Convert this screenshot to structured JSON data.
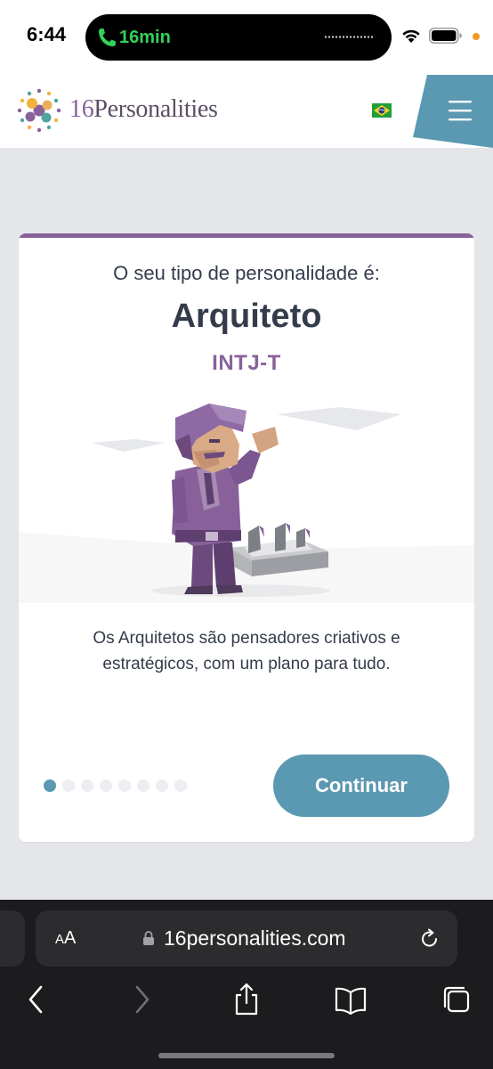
{
  "status_bar": {
    "time": "6:44",
    "call_duration": "16min"
  },
  "header": {
    "logo_number": "16",
    "logo_word": "Personalities",
    "language_flag": "brazil-flag",
    "menu_icon": "hamburger-icon"
  },
  "card": {
    "intro": "O seu tipo de personalidade é:",
    "title": "Arquiteto",
    "code": "INTJ-T",
    "description": "Os Arquitetos são pensadores criativos e estratégicos, com um plano para tudo.",
    "pager_total": 8,
    "pager_active": 1,
    "continue_label": "Continuar"
  },
  "colors": {
    "accent_purple": "#88619a",
    "button_blue": "#5b98b1",
    "text_dark": "#343c4b",
    "background": "#e4e6ea"
  },
  "safari": {
    "text_size_label": "AA",
    "url": "16personalities.com",
    "toolbar_icons": [
      "back-icon",
      "forward-icon",
      "share-icon",
      "bookmarks-icon",
      "tabs-icon"
    ]
  }
}
